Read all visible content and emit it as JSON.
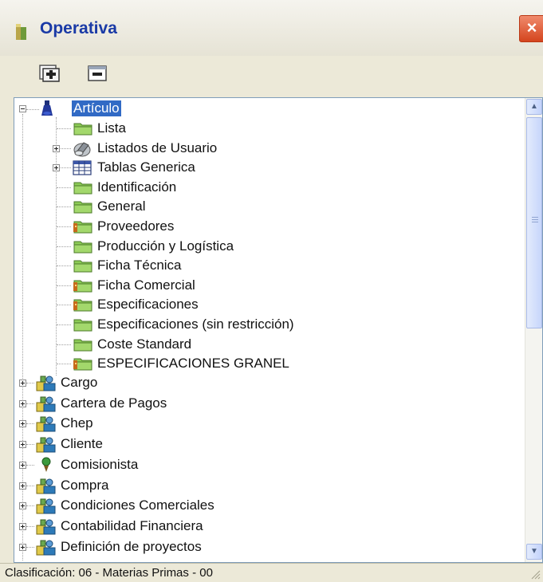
{
  "window": {
    "title": "Operativa",
    "close_label": "×"
  },
  "toolbar": {
    "expand_all_icon": "expand-all-icon",
    "collapse_all_icon": "collapse-all-icon"
  },
  "tree": {
    "root": {
      "label": "Artículo",
      "icon": "flask-icon",
      "expanded": true,
      "selected": true,
      "children": [
        {
          "label": "Lista",
          "icon": "folder-icon"
        },
        {
          "label": "Listados de Usuario",
          "icon": "reports-icon",
          "expandable": true
        },
        {
          "label": "Tablas Generica",
          "icon": "table-icon",
          "expandable": true
        },
        {
          "label": "Identificación",
          "icon": "folder-icon"
        },
        {
          "label": "General",
          "icon": "folder-icon"
        },
        {
          "label": "Proveedores",
          "icon": "folder-key-icon"
        },
        {
          "label": "Producción y Logística",
          "icon": "folder-icon"
        },
        {
          "label": "Ficha Técnica",
          "icon": "folder-icon"
        },
        {
          "label": "Ficha Comercial",
          "icon": "folder-key-icon"
        },
        {
          "label": "Especificaciones",
          "icon": "folder-key-icon"
        },
        {
          "label": "Especificaciones (sin restricción)",
          "icon": "folder-icon"
        },
        {
          "label": "Coste Standard",
          "icon": "folder-icon"
        },
        {
          "label": "ESPECIFICACIONES GRANEL",
          "icon": "folder-key-icon"
        }
      ]
    },
    "modules": [
      {
        "label": "Cargo",
        "icon": "module-icon"
      },
      {
        "label": "Cartera de Pagos",
        "icon": "module-icon"
      },
      {
        "label": "Chep",
        "icon": "module-icon"
      },
      {
        "label": "Cliente",
        "icon": "module-icon"
      },
      {
        "label": "Comisionista",
        "icon": "green-dot-icon"
      },
      {
        "label": "Compra",
        "icon": "module-icon"
      },
      {
        "label": "Condiciones Comerciales",
        "icon": "module-icon"
      },
      {
        "label": "Contabilidad Financiera",
        "icon": "module-icon"
      },
      {
        "label": "Definición de proyectos",
        "icon": "module-icon"
      }
    ]
  },
  "scrollbar": {
    "up_icon": "scroll-up-arrow-icon",
    "down_icon": "scroll-down-arrow-icon"
  },
  "status": {
    "text": "Clasificación: 06 - Materias Primas - 00"
  },
  "colors": {
    "selection": "#316ac5",
    "title_text": "#1a3aa6",
    "folder_green": "#7cbf4a",
    "close_button": "#d4451e"
  }
}
